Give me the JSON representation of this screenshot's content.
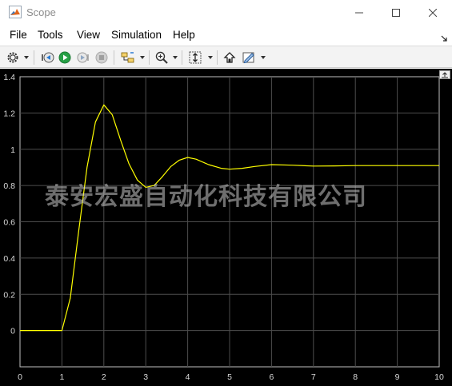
{
  "window": {
    "title": "Scope"
  },
  "menu": {
    "items": [
      "File",
      "Tools",
      "View",
      "Simulation",
      "Help"
    ]
  },
  "toolbar": {
    "buttons": [
      "gear-icon",
      "step-back-icon",
      "run-icon",
      "step-forward-icon",
      "stop-icon",
      "signal-select-icon",
      "zoom-icon",
      "scale-axes-icon",
      "restore-icon",
      "pen-edit-icon"
    ]
  },
  "watermark": {
    "text": "泰安宏盛自动化科技有限公司"
  },
  "colors": {
    "background": "#000000",
    "grid": "#4d4d4d",
    "axes": "#bfbfbf",
    "signal": "#ffff00",
    "labels": "#d9d9d9"
  },
  "chart_data": {
    "type": "line",
    "title": "",
    "xlabel": "",
    "ylabel": "",
    "xlim": [
      0,
      10
    ],
    "ylim": [
      -0.2,
      1.4
    ],
    "xticks": [
      "0",
      "1",
      "2",
      "3",
      "4",
      "5",
      "6",
      "7",
      "8",
      "9",
      "10"
    ],
    "yticks": [
      "0",
      "0.2",
      "0.4",
      "0.6",
      "0.8",
      "1",
      "1.2",
      "1.4"
    ],
    "grid": true,
    "series": [
      {
        "x": [
          0,
          1,
          1.2,
          1.4,
          1.6,
          1.8,
          2.0,
          2.2,
          2.4,
          2.6,
          2.8,
          3.0,
          3.2,
          3.4,
          3.6,
          3.8,
          4.0,
          4.2,
          4.5,
          4.8,
          5.0,
          5.3,
          5.6,
          6.0,
          6.5,
          7.0,
          7.5,
          8.0,
          9.0,
          10.0
        ],
        "y": [
          0,
          0,
          0.18,
          0.55,
          0.9,
          1.15,
          1.245,
          1.19,
          1.05,
          0.92,
          0.83,
          0.79,
          0.8,
          0.85,
          0.905,
          0.94,
          0.955,
          0.945,
          0.915,
          0.895,
          0.89,
          0.895,
          0.905,
          0.915,
          0.912,
          0.907,
          0.908,
          0.91,
          0.91,
          0.91
        ]
      }
    ]
  }
}
